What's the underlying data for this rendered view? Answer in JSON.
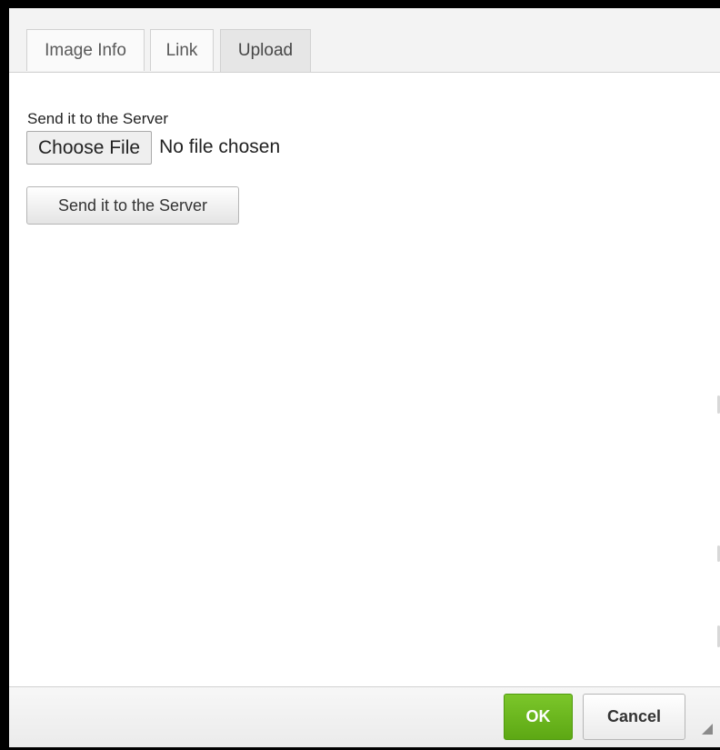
{
  "dialog": {
    "tabs": [
      {
        "label": "Image Info",
        "active": false
      },
      {
        "label": "Link",
        "active": false
      },
      {
        "label": "Upload",
        "active": true
      }
    ]
  },
  "upload": {
    "section_label": "Send it to the Server",
    "choose_file_label": "Choose File",
    "file_status": "No file chosen",
    "send_button_label": "Send it to the Server"
  },
  "footer": {
    "ok_label": "OK",
    "cancel_label": "Cancel",
    "colors": {
      "ok_green": "#6ab51f"
    }
  },
  "icons": {
    "resize": "resize-grip-icon"
  }
}
